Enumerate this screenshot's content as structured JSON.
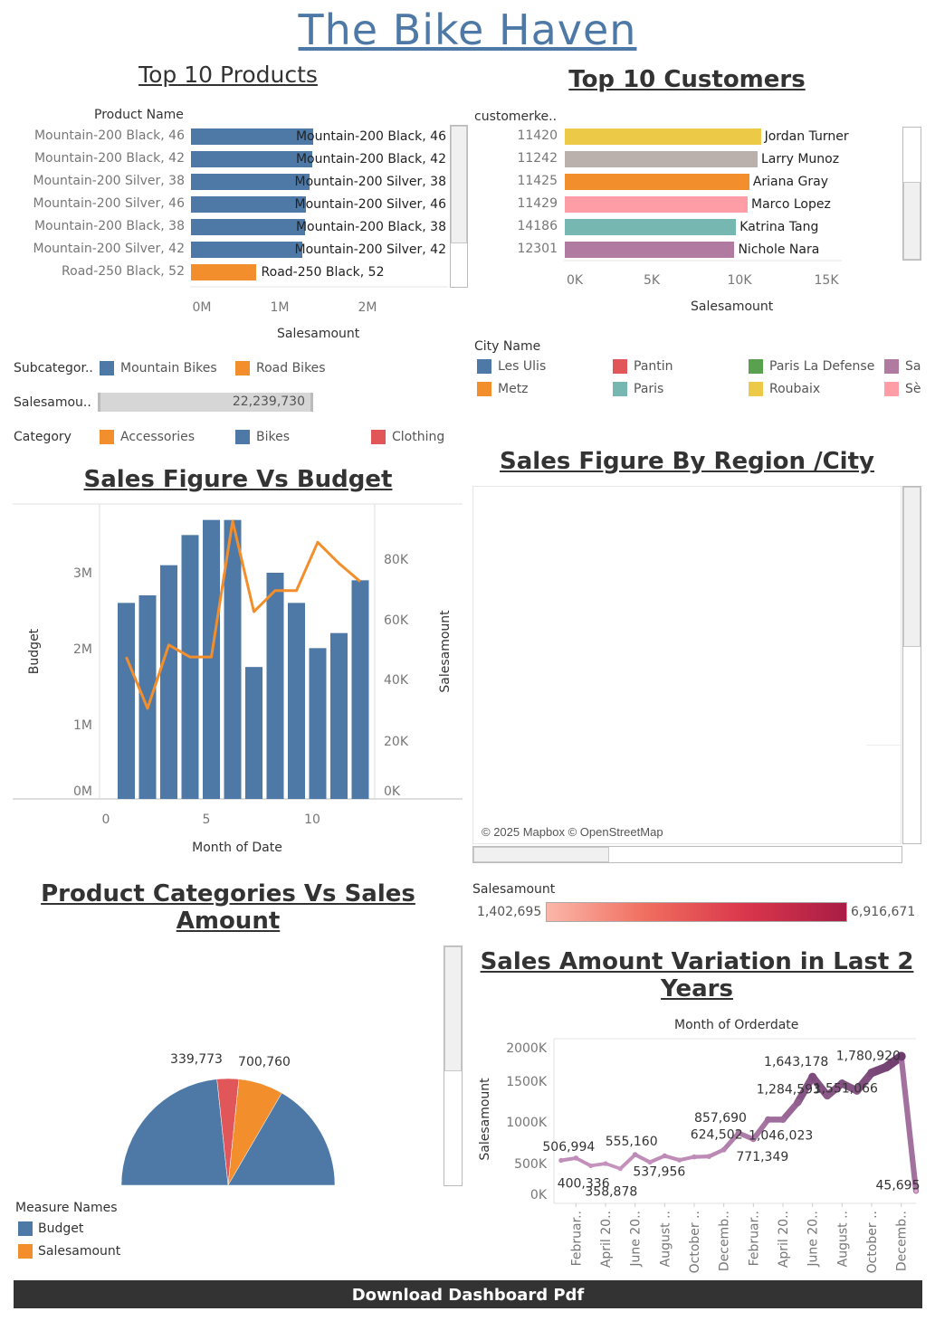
{
  "dashboard": {
    "title": "The Bike Haven",
    "download_label": "Download Dashboard Pdf"
  },
  "colors": {
    "blue": "#4e79a7",
    "orange": "#f28e2b",
    "red": "#e15759",
    "green": "#59a14f",
    "teal": "#76b7b2",
    "yellow": "#edc948",
    "purple": "#b07aa1",
    "pink": "#ff9da7",
    "gray": "#bab0ac",
    "header_bar": "#333333"
  },
  "top_products": {
    "title": "Top 10 Products",
    "column_header": "Product Name",
    "x_axis_label": "Salesamount",
    "rows": [
      {
        "label": "Mountain-200 Black, 46",
        "bar_label": "Mountain-200 Black, 46",
        "color": "#4e79a7"
      },
      {
        "label": "Mountain-200 Black, 42",
        "bar_label": "Mountain-200 Black, 42",
        "color": "#4e79a7"
      },
      {
        "label": "Mountain-200 Silver, 38",
        "bar_label": "Mountain-200 Silver, 38",
        "color": "#4e79a7"
      },
      {
        "label": "Mountain-200 Silver, 46",
        "bar_label": "Mountain-200 Silver, 46",
        "color": "#4e79a7"
      },
      {
        "label": "Mountain-200 Black, 38",
        "bar_label": "Mountain-200 Black, 38",
        "color": "#4e79a7"
      },
      {
        "label": "Mountain-200 Silver, 42",
        "bar_label": "Mountain-200 Silver, 42",
        "color": "#4e79a7"
      },
      {
        "label": "Road-250 Black, 52",
        "bar_label": "Road-250 Black, 52",
        "color": "#f28e2b"
      }
    ],
    "ticks": [
      "0M",
      "1M",
      "2M"
    ]
  },
  "top_customers": {
    "title": "Top 10 Customers",
    "column_header": "customerke..",
    "x_axis_label": "Salesamount",
    "rows": [
      {
        "key": "11420",
        "name": "Jordan Turner",
        "color": "#edc948"
      },
      {
        "key": "11242",
        "name": "Larry Munoz",
        "color": "#bab0ac"
      },
      {
        "key": "11425",
        "name": "Ariana Gray",
        "color": "#f28e2b"
      },
      {
        "key": "11429",
        "name": "Marco Lopez",
        "color": "#ff9da7"
      },
      {
        "key": "14186",
        "name": "Katrina Tang",
        "color": "#76b7b2"
      },
      {
        "key": "12301",
        "name": "Nichole Nara",
        "color": "#b07aa1"
      }
    ],
    "ticks": [
      "0K",
      "5K",
      "10K",
      "15K"
    ]
  },
  "filters": {
    "subcategory": {
      "label": "Subcategor..",
      "items": [
        {
          "name": "Mountain Bikes",
          "color": "#4e79a7"
        },
        {
          "name": "Road Bikes",
          "color": "#f28e2b"
        }
      ]
    },
    "salesamount": {
      "label": "Salesamou..",
      "value": "22,239,730",
      "fill": 1.0
    },
    "category": {
      "label": "Category",
      "items": [
        {
          "name": "Accessories",
          "color": "#f28e2b"
        },
        {
          "name": "Bikes",
          "color": "#4e79a7"
        },
        {
          "name": "Clothing",
          "color": "#e15759"
        }
      ]
    }
  },
  "city_legend": {
    "title": "City Name",
    "items": [
      {
        "name": "Les Ulis",
        "color": "#4e79a7"
      },
      {
        "name": "Pantin",
        "color": "#e15759"
      },
      {
        "name": "Paris La Defense",
        "color": "#59a14f"
      },
      {
        "name": "Sa",
        "color": "#b07aa1"
      },
      {
        "name": "Metz",
        "color": "#f28e2b"
      },
      {
        "name": "Paris",
        "color": "#76b7b2"
      },
      {
        "name": "Roubaix",
        "color": "#edc948"
      },
      {
        "name": "Sè",
        "color": "#ff9da7"
      }
    ]
  },
  "sales_vs_budget": {
    "title": "Sales Figure Vs Budget",
    "x_axis_label": "Month of Date",
    "y_left_label": "Budget",
    "y_right_label": "Salesamount",
    "left_ticks": [
      "0M",
      "1M",
      "2M",
      "3M"
    ],
    "right_ticks": [
      "0K",
      "20K",
      "40K",
      "60K",
      "80K"
    ],
    "x_ticks": [
      "0",
      "5",
      "10"
    ]
  },
  "map": {
    "title": "Sales Figure By Region /City",
    "attribution": "© 2025 Mapbox © OpenStreetMap",
    "legend_title": "Salesamount",
    "legend_min": "1,402,695",
    "legend_max": "6,916,671"
  },
  "categories_vs_sales": {
    "title": "Product Categories Vs Sales Amount",
    "legend_title": "Measure Names",
    "legend_items": [
      {
        "name": "Budget",
        "color": "#4e79a7"
      },
      {
        "name": "Salesamount",
        "color": "#f28e2b"
      }
    ],
    "labels": [
      "339,773",
      "700,760"
    ]
  },
  "variation": {
    "title": "Sales Amount Variation in Last 2 Years",
    "top_axis_label": "Month of Orderdate",
    "y_label": "Salesamount",
    "y_ticks": [
      "0K",
      "500K",
      "1000K",
      "1500K",
      "2000K"
    ],
    "x_ticks": [
      "Februar..",
      "April 20..",
      "June 20..",
      "August ..",
      "October ..",
      "Decemb..",
      "Februar..",
      "April 20..",
      "June 20..",
      "August ..",
      "October ..",
      "Decemb.."
    ]
  },
  "chart_data": [
    {
      "type": "bar",
      "title": "Top 10 Products",
      "xlabel": "Salesamount",
      "ylabel": "Product Name",
      "orientation": "horizontal",
      "categories": [
        "Mountain-200 Black, 46",
        "Mountain-200 Black, 42",
        "Mountain-200 Silver, 38",
        "Mountain-200 Silver, 46",
        "Mountain-200 Black, 38",
        "Mountain-200 Silver, 42",
        "Road-250 Black, 52"
      ],
      "values": [
        1373000,
        1363000,
        1339000,
        1301000,
        1290000,
        1253000,
        730000
      ],
      "xlim": [
        0,
        2900000
      ]
    },
    {
      "type": "bar",
      "title": "Top 10 Customers",
      "xlabel": "Salesamount",
      "ylabel": "customerke..",
      "orientation": "horizontal",
      "categories": [
        "11420",
        "11242",
        "11425",
        "11429",
        "14186",
        "12301"
      ],
      "values": [
        11900,
        11700,
        11200,
        11100,
        10400,
        10300
      ],
      "xlim": [
        0,
        20000
      ]
    },
    {
      "type": "bar",
      "title": "Sales Figure Vs Budget",
      "xlabel": "Month of Date",
      "ylabel": "Budget",
      "x": [
        1,
        2,
        3,
        4,
        5,
        6,
        7,
        8,
        9,
        10,
        11,
        12
      ],
      "series": [
        {
          "name": "Budget",
          "kind": "bar",
          "axis": "left",
          "values": [
            2600000,
            2700000,
            3100000,
            3500000,
            3700000,
            3700000,
            1750000,
            3000000,
            2600000,
            2000000,
            2200000,
            2900000
          ]
        },
        {
          "name": "Salesamount",
          "kind": "line",
          "axis": "right",
          "values": [
            47000,
            30000,
            51000,
            47000,
            47000,
            92000,
            62000,
            69000,
            69000,
            85000,
            78000,
            72000
          ]
        }
      ],
      "ylim": [
        0,
        3700000
      ],
      "y2lim": [
        0,
        93000
      ],
      "xlim": [
        0,
        13
      ]
    },
    {
      "type": "pie",
      "title": "Product Categories Vs Sales Amount",
      "slices": [
        {
          "name": "Budget",
          "value": 22239730
        },
        {
          "name": "339,773",
          "value": 339773
        },
        {
          "name": "700,760",
          "value": 700760
        }
      ],
      "half": true
    },
    {
      "type": "line",
      "title": "Sales Amount Variation in Last 2 Years",
      "xlabel": "Month of Orderdate",
      "ylabel": "Salesamount",
      "x": [
        "2019-01",
        "2019-02",
        "2019-03",
        "2019-04",
        "2019-05",
        "2019-06",
        "2019-07",
        "2019-08",
        "2019-09",
        "2019-10",
        "2019-11",
        "2019-12",
        "2020-01",
        "2020-02",
        "2020-03",
        "2020-04",
        "2020-05",
        "2020-06",
        "2020-07",
        "2020-08",
        "2020-09",
        "2020-10",
        "2020-11",
        "2020-12",
        "2021-01"
      ],
      "values": [
        475000,
        506994,
        400336,
        430000,
        358878,
        555160,
        450000,
        537956,
        480000,
        524000,
        530000,
        624502,
        857690,
        771349,
        1046023,
        1046023,
        1284593,
        1643178,
        1380000,
        1551066,
        1450000,
        1700000,
        1780920,
        1930000,
        45695
      ],
      "data_labels": [
        "506,994",
        "400,336",
        "358,878",
        "555,160",
        "537,956",
        "624,502",
        "857,690",
        "771,349",
        "1,046,023",
        "1,284,593",
        "1,643,178",
        "1,551,066",
        "1,780,920",
        "45,695"
      ],
      "ylim": [
        0,
        2050000
      ]
    }
  ]
}
